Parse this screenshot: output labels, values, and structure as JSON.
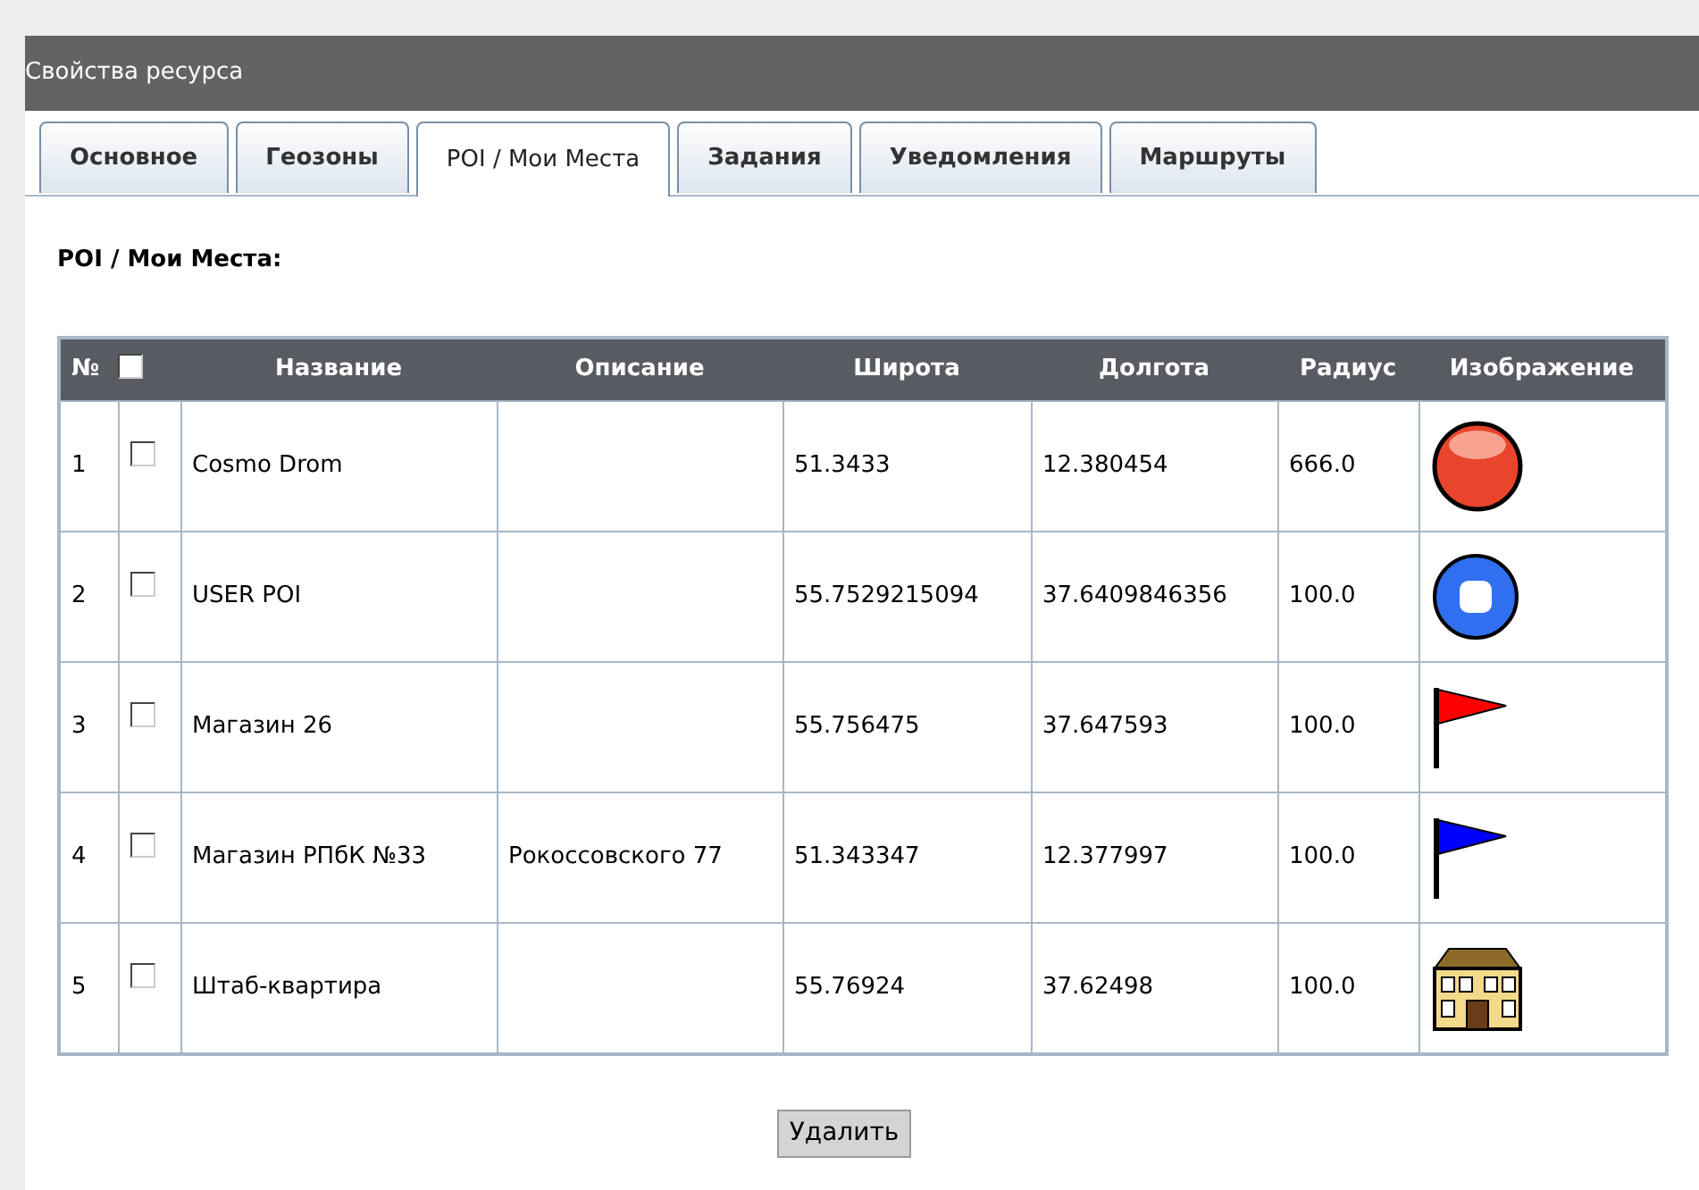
{
  "window": {
    "title": "Свойства ресурса"
  },
  "tabs": [
    {
      "label": "Основное",
      "selected": false
    },
    {
      "label": "Геозоны",
      "selected": false
    },
    {
      "label": "POI / Мои Места",
      "selected": true
    },
    {
      "label": "Задания",
      "selected": false
    },
    {
      "label": "Уведомления",
      "selected": false
    },
    {
      "label": "Маршруты",
      "selected": false
    }
  ],
  "section_title": "POI / Мои Места:",
  "table": {
    "columns": [
      "№",
      "Название",
      "Описание",
      "Широта",
      "Долгота",
      "Радиус",
      "Изображение"
    ],
    "select_all_checked": false,
    "rows": [
      {
        "number": "1",
        "checked": false,
        "name": "Cosmo Drom",
        "description": "",
        "latitude": "51.3433",
        "longitude": "12.380454",
        "radius": "666.0",
        "icon": {
          "kind": "ball",
          "color": "#e8452c"
        }
      },
      {
        "number": "2",
        "checked": false,
        "name": "USER POI",
        "description": "",
        "latitude": "55.7529215094",
        "longitude": "37.6409846356",
        "radius": "100.0",
        "icon": {
          "kind": "ring",
          "color": "#2f6ff0"
        }
      },
      {
        "number": "3",
        "checked": false,
        "name": "Магазин 26",
        "description": "",
        "latitude": "55.756475",
        "longitude": "37.647593",
        "radius": "100.0",
        "icon": {
          "kind": "flag",
          "color": "#ff0000"
        }
      },
      {
        "number": "4",
        "checked": false,
        "name": "Магазин РПбК №33",
        "description": "Рокоссовского 77",
        "latitude": "51.343347",
        "longitude": "12.377997",
        "radius": "100.0",
        "icon": {
          "kind": "flag",
          "color": "#0000ff"
        }
      },
      {
        "number": "5",
        "checked": false,
        "name": "Штаб-квартира",
        "description": "",
        "latitude": "55.76924",
        "longitude": "37.62498",
        "radius": "100.0",
        "icon": {
          "kind": "building",
          "color": "#f3d98a"
        }
      }
    ]
  },
  "delete_button": "Удалить"
}
